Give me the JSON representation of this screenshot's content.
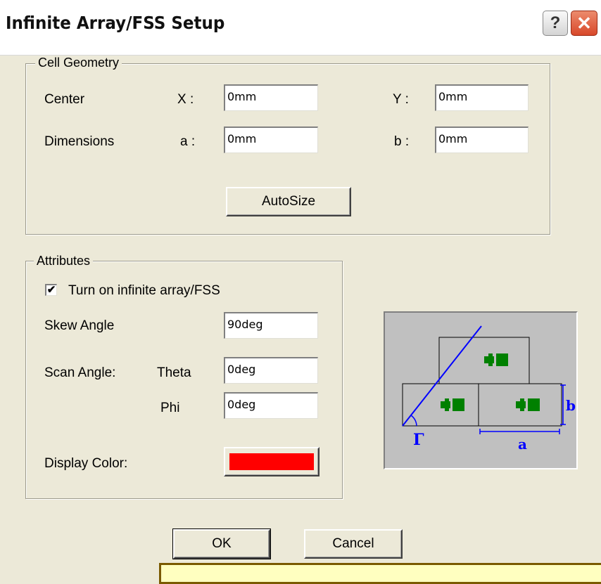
{
  "window": {
    "title": "Infinite Array/FSS Setup",
    "help_label": "?",
    "close_label": "✕"
  },
  "cell_geometry": {
    "legend": "Cell Geometry",
    "center_label": "Center",
    "x_label": "X :",
    "x_value": "0mm",
    "y_label": "Y :",
    "y_value": "0mm",
    "dimensions_label": "Dimensions",
    "a_label": "a :",
    "a_value": "0mm",
    "b_label": "b :",
    "b_value": "0mm",
    "autosize_label": "AutoSize"
  },
  "attributes": {
    "legend": "Attributes",
    "infinite_array_checkbox": {
      "label": "Turn on infinite array/FSS",
      "checked": true,
      "mark": "✔"
    },
    "skew_angle_label": "Skew Angle",
    "skew_angle_value": "90deg",
    "scan_angle_label": "Scan Angle:",
    "theta_label": "Theta",
    "theta_value": "0deg",
    "phi_label": "Phi",
    "phi_value": "0deg",
    "display_color_label": "Display Color:",
    "display_color": "#ff0000"
  },
  "diagram": {
    "gamma_label": "Γ",
    "a_label": "a",
    "b_label": "b",
    "line_color": "#0000ff",
    "element_color": "#008000"
  },
  "buttons": {
    "ok_label": "OK",
    "cancel_label": "Cancel"
  }
}
